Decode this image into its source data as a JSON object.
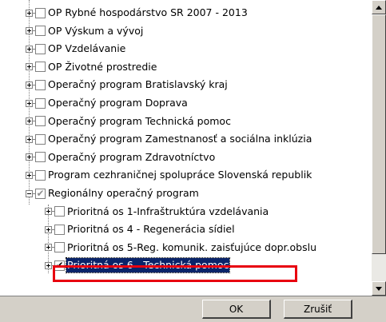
{
  "tree": {
    "items": [
      {
        "label": "OP Rybné hospodárstvo SR 2007 - 2013",
        "level": 0,
        "expander": "plus",
        "check": "none"
      },
      {
        "label": "OP Výskum a vývoj",
        "level": 0,
        "expander": "plus",
        "check": "none"
      },
      {
        "label": "OP Vzdelávanie",
        "level": 0,
        "expander": "plus",
        "check": "none"
      },
      {
        "label": "OP Životné prostredie",
        "level": 0,
        "expander": "plus",
        "check": "none"
      },
      {
        "label": "Operačný program Bratislavský kraj",
        "level": 0,
        "expander": "plus",
        "check": "none"
      },
      {
        "label": "Operačný program Doprava",
        "level": 0,
        "expander": "plus",
        "check": "none"
      },
      {
        "label": "Operačný program Technická pomoc",
        "level": 0,
        "expander": "plus",
        "check": "none"
      },
      {
        "label": "Operačný program Zamestnanosť a sociálna inklúzia",
        "level": 0,
        "expander": "plus",
        "check": "none"
      },
      {
        "label": "Operačný program Zdravotníctvo",
        "level": 0,
        "expander": "plus",
        "check": "none"
      },
      {
        "label": "Program cezhraničnej spolupráce Slovenská republik",
        "level": 0,
        "expander": "plus",
        "check": "none"
      },
      {
        "label": "Regionálny operačný program",
        "level": 0,
        "expander": "minus",
        "check": "partial"
      },
      {
        "label": "Prioritná os 1-Infraštruktúra vzdelávania",
        "level": 1,
        "expander": "plus",
        "check": "none"
      },
      {
        "label": "Prioritná os 4 - Regenerácia sídiel",
        "level": 1,
        "expander": "plus",
        "check": "none"
      },
      {
        "label": "Prioritná os 5-Reg. komunik. zaisťujúce dopr.obslu",
        "level": 1,
        "expander": "plus",
        "check": "none"
      },
      {
        "label": "Prioritná os 6 - Technická pomoc",
        "level": 1,
        "expander": "plus",
        "check": "checked",
        "selected": true
      }
    ]
  },
  "buttons": {
    "ok_label": "OK",
    "cancel_label": "Zrušiť"
  },
  "colors": {
    "selection": "#0a246a",
    "highlight_box": "#e8000f",
    "dialog_face": "#d4d0c8"
  },
  "icons": {
    "check_mark": "✔"
  }
}
